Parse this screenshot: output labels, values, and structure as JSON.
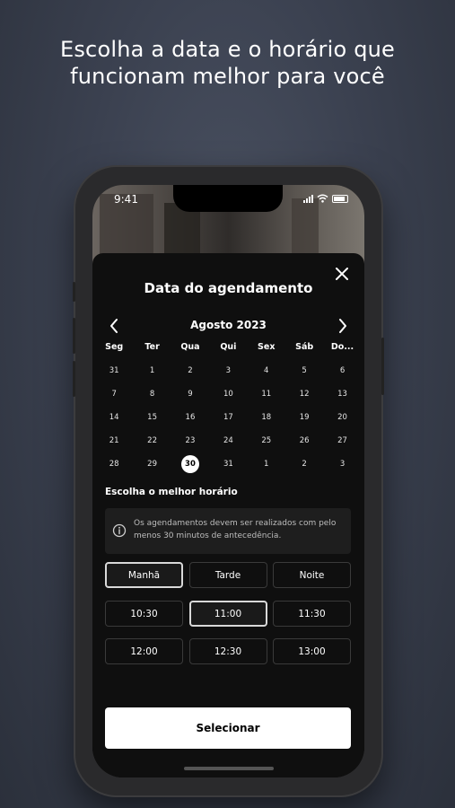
{
  "headline": "Escolha a data e o horário que funcionam melhor para você",
  "status_bar": {
    "time": "9:41"
  },
  "sheet": {
    "title": "Data do agendamento",
    "month": "Agosto 2023",
    "weekdays": [
      "Seg",
      "Ter",
      "Qua",
      "Qui",
      "Sex",
      "Sáb",
      "Do..."
    ],
    "weeks": [
      [
        "31",
        "1",
        "2",
        "3",
        "4",
        "5",
        "6"
      ],
      [
        "7",
        "8",
        "9",
        "10",
        "11",
        "12",
        "13"
      ],
      [
        "14",
        "15",
        "16",
        "17",
        "18",
        "19",
        "20"
      ],
      [
        "21",
        "22",
        "23",
        "24",
        "25",
        "26",
        "27"
      ],
      [
        "28",
        "29",
        "30",
        "31",
        "1",
        "2",
        "3"
      ]
    ],
    "selected_day": "30",
    "time_section_title": "Escolha o melhor horário",
    "info_text": "Os agendamentos devem ser realizados com pelo menos 30 minutos de antecedência.",
    "periods": [
      "Manhã",
      "Tarde",
      "Noite"
    ],
    "active_period": "Manhã",
    "time_slots_row1": [
      "10:30",
      "11:00",
      "11:30"
    ],
    "time_slots_row2": [
      "12:00",
      "12:30",
      "13:00"
    ],
    "selected_time": "11:00",
    "select_button_label": "Selecionar"
  },
  "colors": {
    "background": "#3b4150",
    "sheet": "#0f0f0f",
    "accent": "#ffffff"
  },
  "icons": [
    "close-icon",
    "chevron-left-icon",
    "chevron-right-icon",
    "info-icon",
    "signal-icon",
    "wifi-icon",
    "battery-icon"
  ]
}
